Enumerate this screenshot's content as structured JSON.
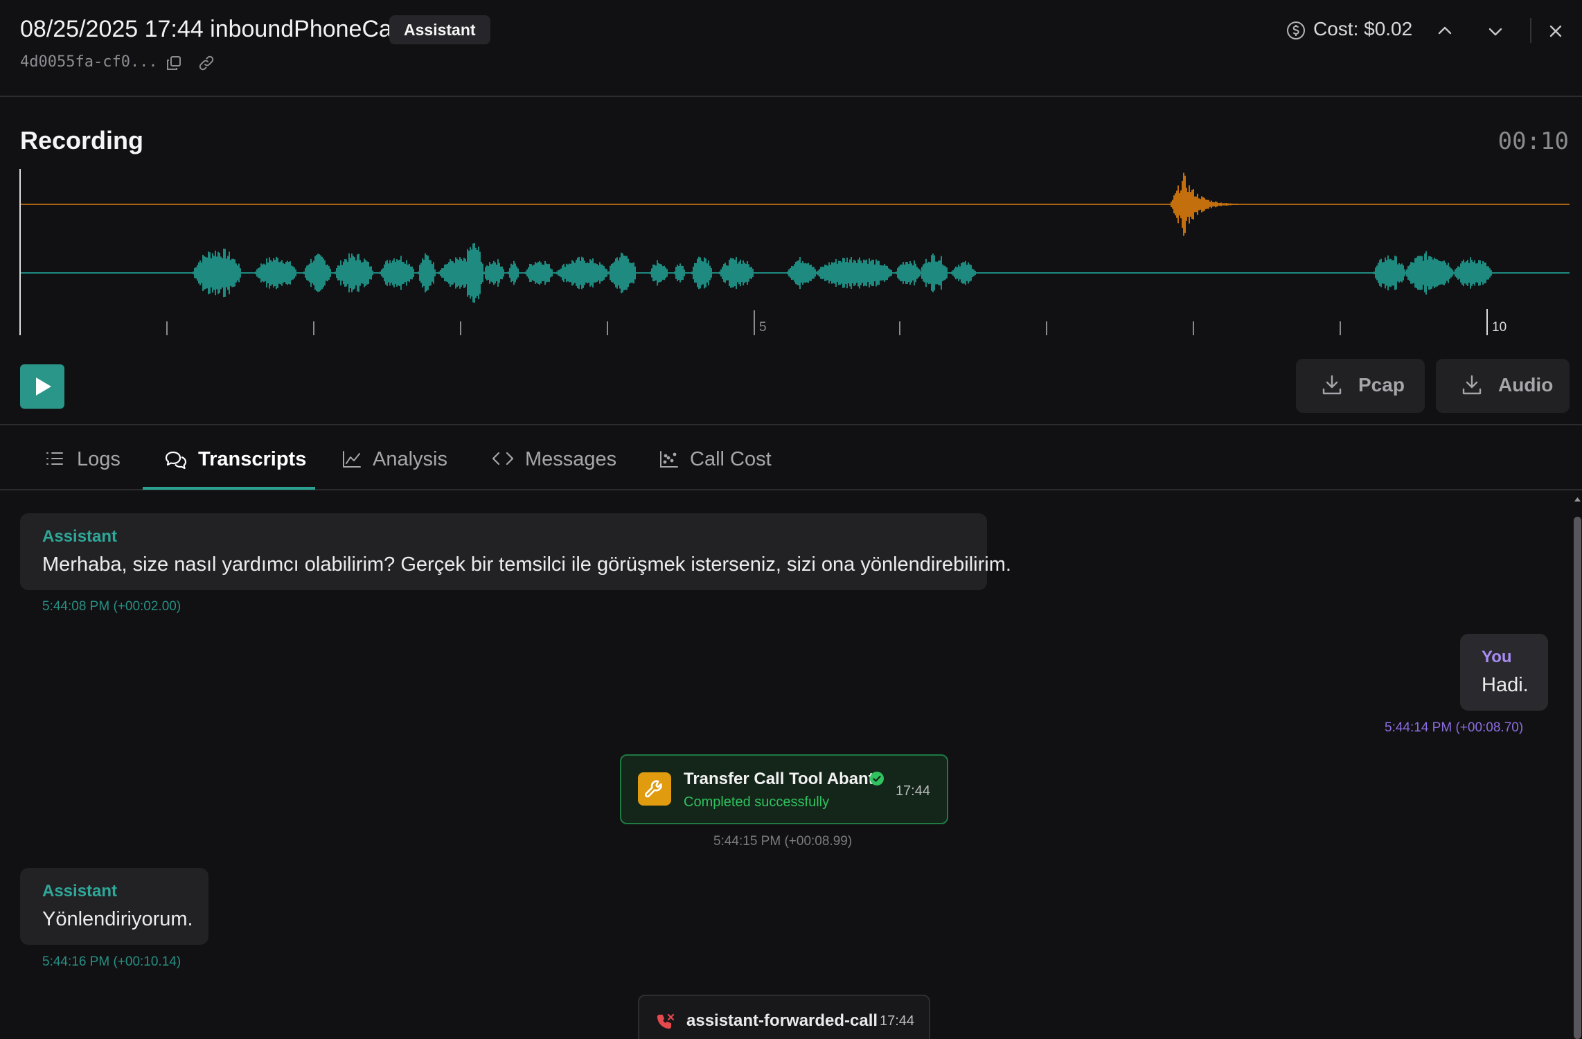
{
  "header": {
    "title": "08/25/2025 17:44 inboundPhoneCall",
    "role_chip": "Assistant",
    "call_id": "4d0055fa-cf0...",
    "cost": "Cost: $0.02"
  },
  "recording": {
    "title": "Recording",
    "duration": "00:10",
    "tick_labels": [
      "5",
      "10"
    ],
    "download_buttons": {
      "pcap": "Pcap",
      "audio": "Audio"
    },
    "colors": {
      "assistant_track": "#1f8a80",
      "user_track": "#c46f0e"
    }
  },
  "tabs": [
    {
      "label": "Logs",
      "icon": "list-icon"
    },
    {
      "label": "Transcripts",
      "icon": "chat-bubbles-icon",
      "active": true
    },
    {
      "label": "Analysis",
      "icon": "line-chart-icon"
    },
    {
      "label": "Messages",
      "icon": "code-icon"
    },
    {
      "label": "Call Cost",
      "icon": "scatter-chart-icon"
    }
  ],
  "transcript": {
    "messages": [
      {
        "role": "Assistant",
        "text": "Merhaba, size nasıl yardımcı olabilirim? Gerçek bir temsilci ile görüşmek isterseniz, sizi ona yönlendirebilirim.",
        "timestamp": "5:44:08 PM  (+00:02.00)"
      },
      {
        "role": "You",
        "text": "Hadi.",
        "timestamp": "5:44:14 PM  (+00:08.70)"
      },
      {
        "role": "Assistant",
        "text": "Yönlendiriyorum.",
        "timestamp": "5:44:16 PM  (+00:10.14)"
      }
    ],
    "tool_call": {
      "name": "Transfer Call Tool Abant",
      "status": "Completed successfully",
      "time": "17:44",
      "timestamp": "5:44:15 PM  (+00:08.99)"
    },
    "event": {
      "name": "assistant-forwarded-call",
      "time": "17:44"
    }
  }
}
